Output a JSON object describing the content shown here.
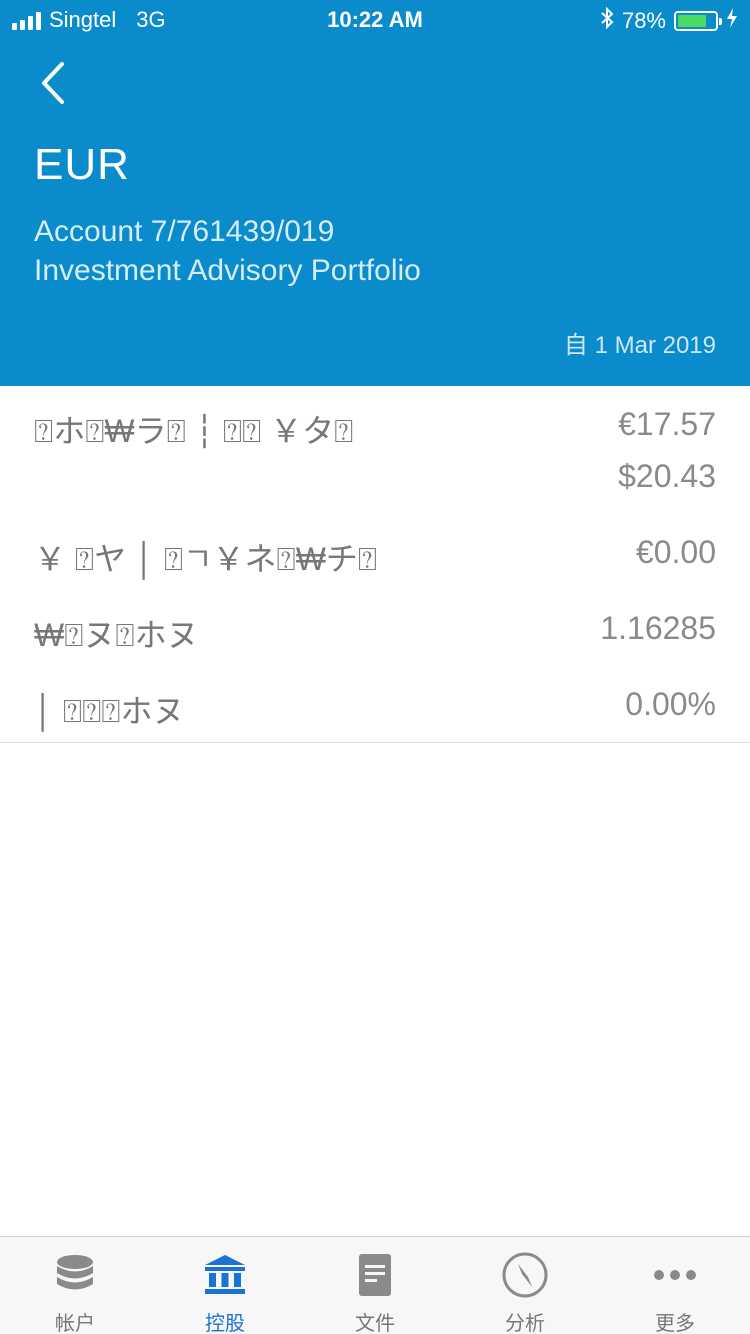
{
  "status_bar": {
    "carrier": "Singtel",
    "network": "3G",
    "time": "10:22 AM",
    "battery_percent": "78%",
    "battery_level": 0.78
  },
  "header": {
    "currency": "EUR",
    "account_line": "Account 7/761439/019",
    "portfolio_name": "Investment Advisory Portfolio",
    "since_date": "自 1 Mar 2019"
  },
  "rows": [
    {
      "label": "⍰ホ⍰₩ラ⍰ ┆ ⍰⍰ ￥タ⍰",
      "value": "€17.57",
      "value2": "$20.43"
    },
    {
      "label": "￥ ⍰ヤ │ ⍰ㄱ￥ネ⍰₩チ⍰",
      "value": "€0.00"
    },
    {
      "label": "₩⍰ヌ⍰ホヌ",
      "value": "1.16285"
    },
    {
      "label": "│ ⍰⍰⍰ホヌ",
      "value": "0.00%"
    }
  ],
  "tabs": [
    {
      "label": "帐户",
      "icon": "database-icon"
    },
    {
      "label": "控股",
      "icon": "bank-icon",
      "active": true
    },
    {
      "label": "文件",
      "icon": "document-icon"
    },
    {
      "label": "分析",
      "icon": "compass-icon"
    },
    {
      "label": "更多",
      "icon": "more-icon"
    }
  ],
  "colors": {
    "header_bg": "#0a8ccc",
    "active_tab": "#1a73d4",
    "battery_fill": "#4cd964"
  }
}
